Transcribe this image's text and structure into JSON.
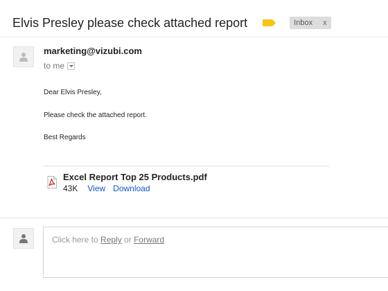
{
  "header": {
    "subject": "Elvis Presley please check attached report",
    "label_color": "#f5c518",
    "inbox_chip": {
      "label": "Inbox",
      "remove": "x"
    }
  },
  "message": {
    "sender_email": "marketing@vizubi.com",
    "recipient": "to me",
    "body": {
      "greeting": "Dear Elvis Presley,",
      "line1": "Please check the attached report.",
      "closing": "Best Regards"
    }
  },
  "attachment": {
    "icon": "pdf-file-icon",
    "filename": "Excel Report Top 25 Products.pdf",
    "size": "43K",
    "view_label": "View",
    "download_label": "Download"
  },
  "reply": {
    "prefix": "Click here to ",
    "reply_label": "Reply",
    "middle": " or ",
    "forward_label": "Forward"
  },
  "colors": {
    "link": "#1155cc",
    "pdf_red": "#d22b2b"
  }
}
